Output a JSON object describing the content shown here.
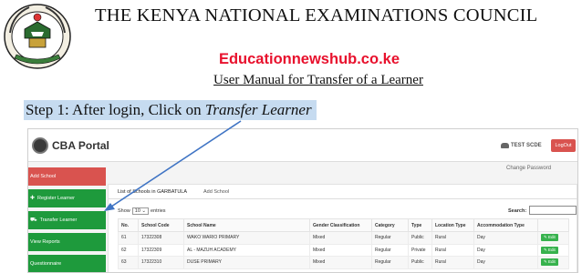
{
  "header": {
    "title": "THE KENYA NATIONAL EXAMINATIONS COUNCIL",
    "website": "Educationnewshub.co.ke",
    "subtitle": "User Manual for Transfer of a Learner",
    "step_prefix": "Step 1: After login, Click on ",
    "step_link": "Transfer Learner",
    "step_highlight_color": "#c6dbf0",
    "website_color": "#e8112d"
  },
  "crest": {
    "icon": "knec-crest-logo"
  },
  "portal": {
    "brand": "CBA Portal",
    "brand_icon": "knec-logo-icon",
    "user_name": "TEST SCDE",
    "logout_label": "LogOut",
    "change_password": "Change Password",
    "sidebar": [
      {
        "label": "Add School",
        "color": "red",
        "icon": ""
      },
      {
        "label": "Register Learner",
        "color": "green",
        "icon": "plus-icon"
      },
      {
        "label": "Transfer Learner",
        "color": "green",
        "icon": "truck-icon"
      },
      {
        "label": "View Reports",
        "color": "green",
        "icon": ""
      },
      {
        "label": "Questionnaire",
        "color": "green",
        "icon": ""
      }
    ],
    "tabs": [
      "List of Schools in GARBATULA",
      "Add School"
    ],
    "show_label": "Show",
    "show_value": "10",
    "entries_label": "entries",
    "search_label": "Search:",
    "columns": [
      "No.",
      "School Code",
      "School Name",
      "Gender Classification",
      "Category",
      "Type",
      "Location Type",
      "Accommodation Type",
      ""
    ],
    "rows": [
      {
        "no": "61",
        "code": "17322308",
        "name": "WAKO WARIO PRIMARY",
        "gender": "Mixed",
        "category": "Regular",
        "type": "Public",
        "location": "Rural",
        "accommodation": "Day",
        "action": "Edit"
      },
      {
        "no": "62",
        "code": "17322309",
        "name": "AL - MAZUH ACADEMY",
        "gender": "Mixed",
        "category": "Regular",
        "type": "Private",
        "location": "Rural",
        "accommodation": "Day",
        "action": "Edit"
      },
      {
        "no": "63",
        "code": "17322310",
        "name": "DUSE PRIMARY",
        "gender": "Mixed",
        "category": "Regular",
        "type": "Public",
        "location": "Rural",
        "accommodation": "Day",
        "action": "Edit"
      }
    ],
    "colors": {
      "green": "#1e9a3c",
      "red": "#d9534f",
      "edit": "#37b24d"
    }
  }
}
